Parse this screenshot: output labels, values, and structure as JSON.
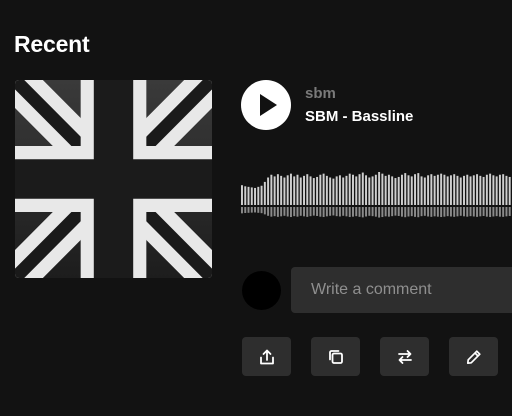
{
  "section": {
    "title": "Recent"
  },
  "track": {
    "artist": "sbm",
    "title": "SBM - Bassline",
    "artwork_icon": "union-jack-artwork"
  },
  "player": {
    "play_icon": "play-icon",
    "waveform_levels": [
      0.36,
      0.34,
      0.33,
      0.32,
      0.31,
      0.33,
      0.35,
      0.42,
      0.5,
      0.55,
      0.52,
      0.56,
      0.53,
      0.5,
      0.54,
      0.57,
      0.52,
      0.55,
      0.5,
      0.53,
      0.56,
      0.52,
      0.49,
      0.51,
      0.55,
      0.57,
      0.53,
      0.5,
      0.48,
      0.52,
      0.54,
      0.5,
      0.53,
      0.57,
      0.55,
      0.52,
      0.56,
      0.59,
      0.54,
      0.5,
      0.52,
      0.55,
      0.6,
      0.57,
      0.53,
      0.55,
      0.52,
      0.49,
      0.51,
      0.55,
      0.58,
      0.54,
      0.52,
      0.56,
      0.58,
      0.52,
      0.5,
      0.54,
      0.56,
      0.53,
      0.55,
      0.57,
      0.55,
      0.52,
      0.54,
      0.56,
      0.53,
      0.5,
      0.53,
      0.55,
      0.52,
      0.54,
      0.56,
      0.53,
      0.51,
      0.55,
      0.57,
      0.54,
      0.52,
      0.55,
      0.56,
      0.53,
      0.51
    ],
    "colors": {
      "wave": "#cfcfcf",
      "wave_reflection": "#8a8a8a"
    }
  },
  "comment": {
    "placeholder": "Write a comment"
  },
  "actions": [
    {
      "name": "share-button",
      "icon": "share-icon"
    },
    {
      "name": "copy-link-button",
      "icon": "copy-icon"
    },
    {
      "name": "repost-button",
      "icon": "repost-icon"
    },
    {
      "name": "edit-button",
      "icon": "pencil-icon"
    }
  ],
  "colors": {
    "background": "#121212",
    "surface": "#2e2e2e",
    "muted_text": "#7a7a7a"
  }
}
